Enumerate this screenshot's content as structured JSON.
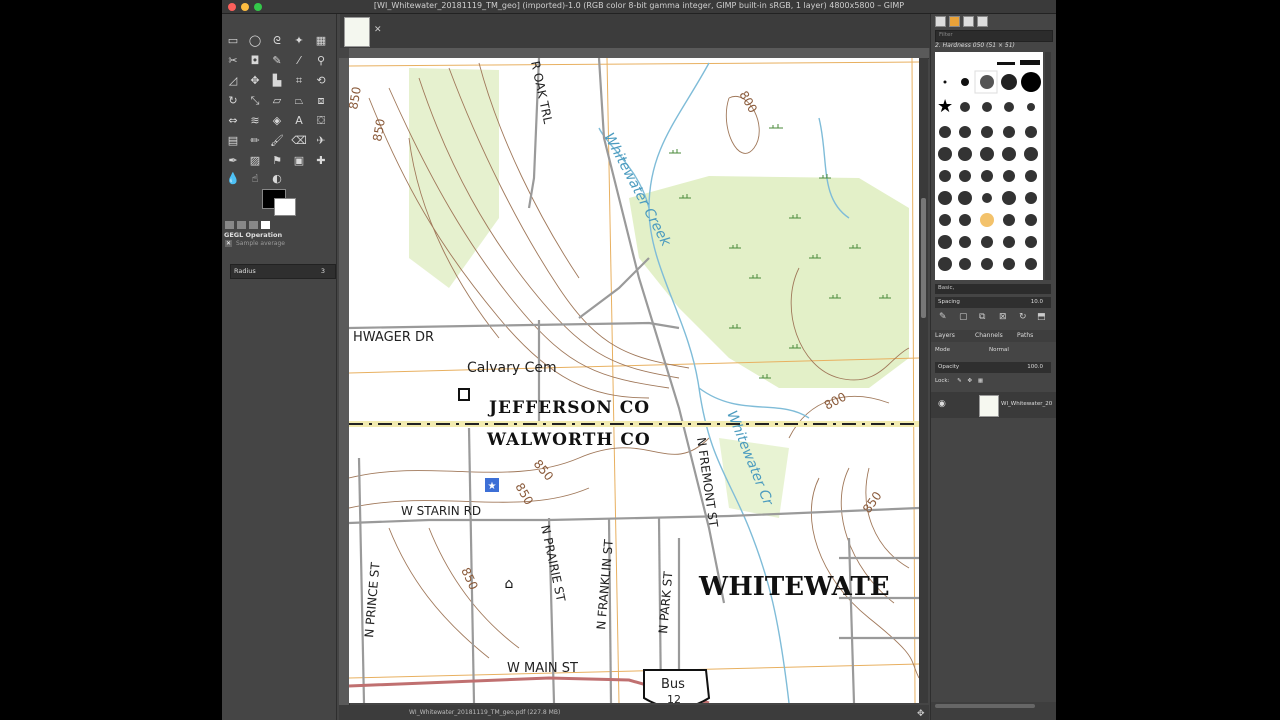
{
  "window": {
    "title": "[WI_Whitewater_20181119_TM_geo] (imported)-1.0 (RGB color 8-bit gamma integer, GIMP built-in sRGB, 1 layer) 4800x5800 – GIMP"
  },
  "toolbox": {
    "tool_options_title": "GEGL Operation",
    "sample_average": "Sample average",
    "radius_label": "Radius",
    "radius_value": "3"
  },
  "map_labels": {
    "oak_trl": "R OAK TRL",
    "hwager": "HWAGER DR",
    "cemetery": "Calvary Cem",
    "jefferson": "JEFFERSON CO",
    "walworth": "WALWORTH CO",
    "starin": "W STARIN RD",
    "prairie": "N PRAIRIE ST",
    "franklin": "N FRANKLIN ST",
    "park": "N PARK ST",
    "fremont": "N FREMONT ST",
    "prince": "N PRINCE ST",
    "main": "W MAIN ST",
    "whitewater_city": "WHITEWATE",
    "creek1": "Whitewater Creek",
    "creek2": "Whitewater Cr",
    "bus": "Bus",
    "bus_num": "12",
    "elev_850_a": "850",
    "elev_850_b": "850",
    "elev_850_c": "850",
    "elev_850_d": "850",
    "elev_850_e": "850",
    "elev_850_f": "850",
    "elev_800_a": "800",
    "elev_800_b": "800"
  },
  "status": {
    "file": "WI_Whitewater_20181119_TM_geo.pdf (227.8 MB)"
  },
  "dock": {
    "filter_placeholder": "Filter",
    "brush_name": "2. Hardness 050 (51 × 51)",
    "preset": "Basic,",
    "spacing_label": "Spacing",
    "spacing_value": "10.0",
    "tab_layers": "Layers",
    "tab_channels": "Channels",
    "tab_paths": "Paths",
    "mode_label": "Mode",
    "mode_value": "Normal",
    "opacity_label": "Opacity",
    "opacity_value": "100.0",
    "lock_label": "Lock:",
    "layer_name": "WI_Whitewater_20"
  },
  "colors": {
    "contour": "#a0785a",
    "water": "#7fbcd8",
    "vegetation": "#e3f0c8",
    "road": "#9a9a9a",
    "grid": "#e8b060",
    "main_road": "#c07070"
  }
}
